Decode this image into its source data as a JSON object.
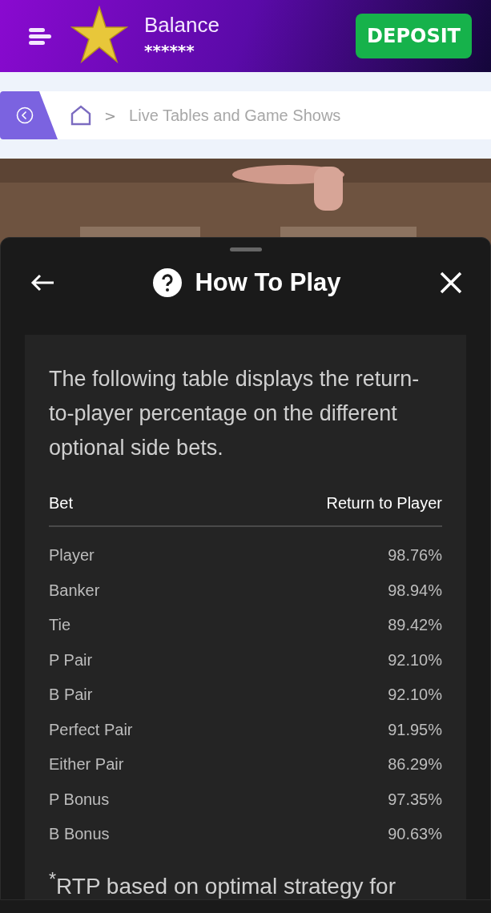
{
  "header": {
    "balance_label": "Balance",
    "balance_value": "******",
    "deposit": "DEPOSIT"
  },
  "breadcrumb": {
    "separator": ">",
    "current": "Live Tables and Game Shows"
  },
  "sheet": {
    "title": "How To Play",
    "intro": "The following table displays the return-to-player percentage on the different optional side bets.",
    "columns": [
      "Bet",
      "Return to Player"
    ],
    "rows": [
      {
        "bet": "Player",
        "rtp": "98.76%"
      },
      {
        "bet": "Banker",
        "rtp": "98.94%"
      },
      {
        "bet": "Tie",
        "rtp": "89.42%"
      },
      {
        "bet": "P Pair",
        "rtp": "92.10%"
      },
      {
        "bet": "B Pair",
        "rtp": "92.10%"
      },
      {
        "bet": "Perfect Pair",
        "rtp": "91.95%"
      },
      {
        "bet": "Either Pair",
        "rtp": "86.29%"
      },
      {
        "bet": "P Bonus",
        "rtp": "97.35%"
      },
      {
        "bet": "B Bonus",
        "rtp": "90.63%"
      }
    ],
    "footnote": "$^{*}$RTP based on optimal strategy for"
  }
}
